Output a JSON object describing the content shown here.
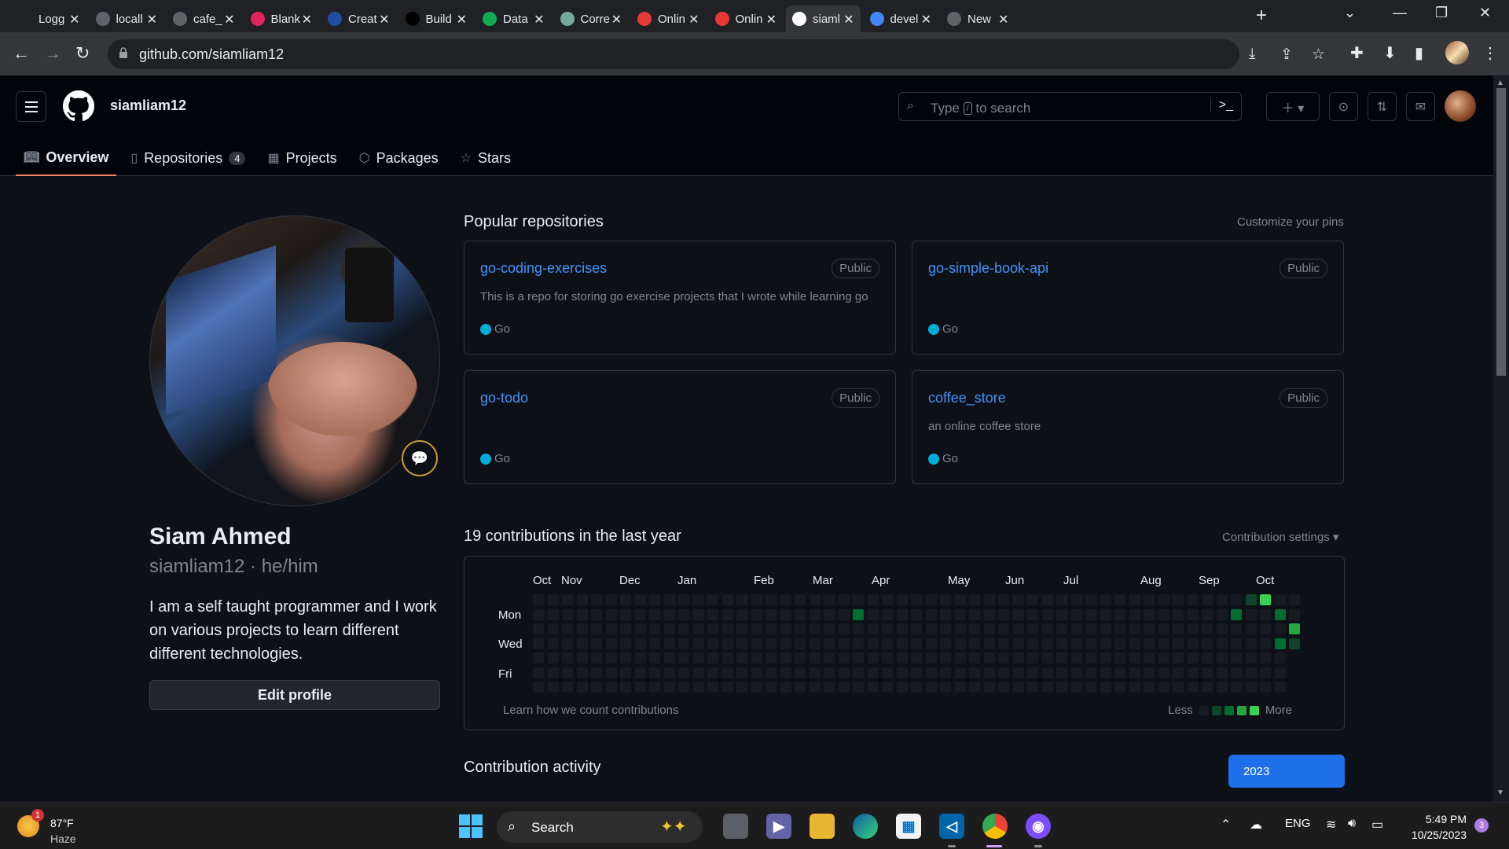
{
  "browser": {
    "tabs": [
      {
        "title": "Logg",
        "fav": "login-icon",
        "color": "#202124"
      },
      {
        "title": "locall",
        "fav": "globe-icon",
        "color": "#5f6368"
      },
      {
        "title": "cafe_",
        "fav": "gmail-icon",
        "color": "#5f6368"
      },
      {
        "title": "Blank",
        "fav": "asterisk-icon",
        "color": "#e0245e"
      },
      {
        "title": "Creat",
        "fav": "gorm-icon",
        "color": "#1f4fa0"
      },
      {
        "title": "Build",
        "fav": "dev-icon",
        "color": "#000000"
      },
      {
        "title": "Data",
        "fav": "mongodb-leaf-icon",
        "color": "#13aa52"
      },
      {
        "title": "Corre",
        "fav": "openai-icon",
        "color": "#74aa9c"
      },
      {
        "title": "Onlin",
        "fav": "online-icon",
        "color": "#e53935"
      },
      {
        "title": "Onlin",
        "fav": "online-icon",
        "color": "#e53935"
      },
      {
        "title": "siaml",
        "fav": "github-icon",
        "color": "#ffffff",
        "active": true
      },
      {
        "title": "devel",
        "fav": "google-icon",
        "color": "#4285f4"
      },
      {
        "title": "New",
        "fav": "chrome-icon",
        "color": "#5f6368"
      }
    ],
    "url": "github.com/siamliam12"
  },
  "header": {
    "username": "siamliam12",
    "search_placeholder": "Type",
    "search_key": "/",
    "search_suffix": "to search"
  },
  "nav": {
    "tabs": [
      {
        "label": "Overview",
        "icon": "book-icon",
        "selected": true
      },
      {
        "label": "Repositories",
        "icon": "repo-icon",
        "count": "4"
      },
      {
        "label": "Projects",
        "icon": "table-icon"
      },
      {
        "label": "Packages",
        "icon": "package-icon"
      },
      {
        "label": "Stars",
        "icon": "star-icon"
      }
    ]
  },
  "profile": {
    "name": "Siam Ahmed",
    "login": "siamliam12 · he/him",
    "bio": "I am a self taught programmer and I work on various projects to learn different different technologies.",
    "edit_label": "Edit profile"
  },
  "pinned": {
    "heading": "Popular repositories",
    "customize": "Customize your pins",
    "repos": [
      {
        "name": "go-coding-exercises",
        "visibility": "Public",
        "description": "This is a repo for storing go exercise projects that I wrote while learning go",
        "language": "Go",
        "lang_color": "#00add8"
      },
      {
        "name": "go-simple-book-api",
        "visibility": "Public",
        "description": "",
        "language": "Go",
        "lang_color": "#00add8"
      },
      {
        "name": "go-todo",
        "visibility": "Public",
        "description": "",
        "language": "Go",
        "lang_color": "#00add8"
      },
      {
        "name": "coffee_store",
        "visibility": "Public",
        "description": "an online coffee store",
        "language": "Go",
        "lang_color": "#00add8"
      }
    ]
  },
  "contributions": {
    "heading": "19 contributions in the last year",
    "settings": "Contribution settings ▾",
    "months": [
      "Oct",
      "Nov",
      "Dec",
      "Jan",
      "Feb",
      "Mar",
      "Apr",
      "May",
      "Jun",
      "Jul",
      "Aug",
      "Sep",
      "Oct"
    ],
    "days": [
      "Mon",
      "Wed",
      "Fri"
    ],
    "weeks": 53,
    "levels": [
      "#161b22",
      "#0e4429",
      "#006d32",
      "#26a641",
      "#39d353"
    ],
    "active_cells": [
      {
        "week": 22,
        "day": 1,
        "level": 2
      },
      {
        "week": 48,
        "day": 1,
        "level": 2
      },
      {
        "week": 49,
        "day": 0,
        "level": 1
      },
      {
        "week": 50,
        "day": 0,
        "level": 4
      },
      {
        "week": 51,
        "day": 1,
        "level": 2
      },
      {
        "week": 51,
        "day": 3,
        "level": 2
      },
      {
        "week": 52,
        "day": 2,
        "level": 3
      },
      {
        "week": 52,
        "day": 3,
        "level": 1
      }
    ],
    "learn": "Learn how we count contributions",
    "less": "Less",
    "more": "More"
  },
  "activity": {
    "heading": "Contribution activity",
    "year": "2023"
  },
  "taskbar": {
    "temp": "87°F",
    "condition": "Haze",
    "weather_badge": "1",
    "search": "Search",
    "lang": "ENG",
    "time": "5:49 PM",
    "date": "10/25/2023",
    "notifications": "3"
  }
}
